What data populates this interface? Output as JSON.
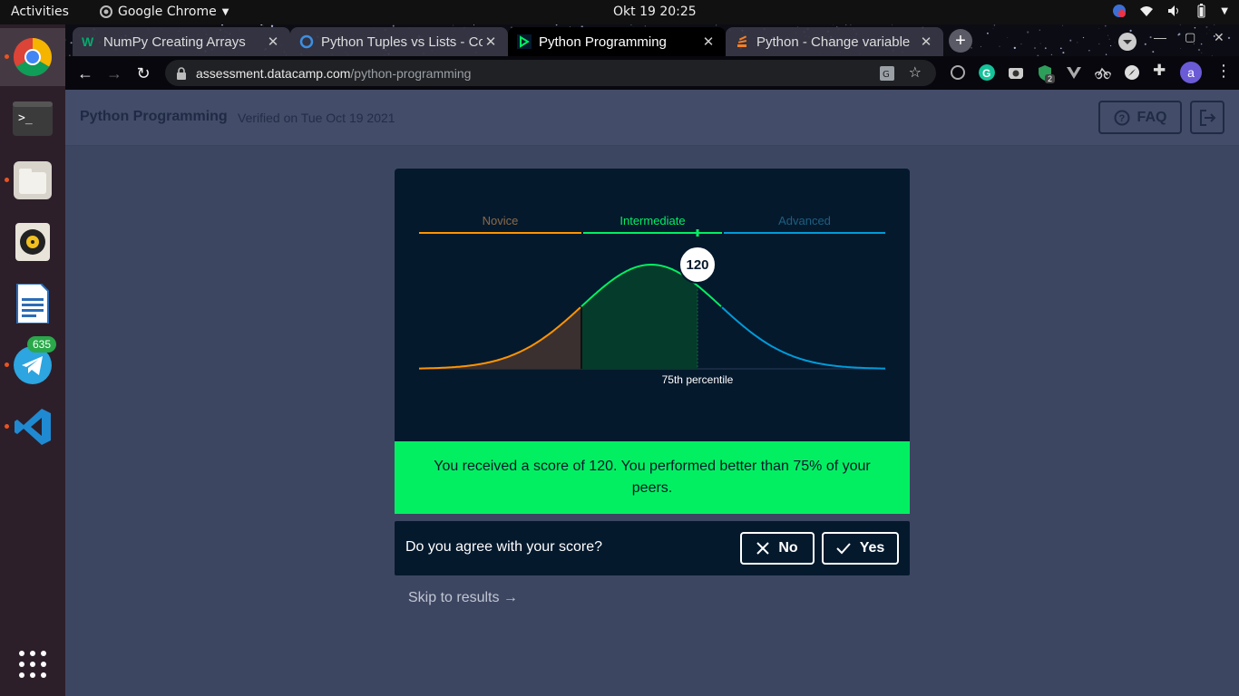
{
  "system": {
    "activities": "Activities",
    "app_name": "Google Chrome",
    "clock": "Okt 19  20:25"
  },
  "dock": {
    "telegram_badge": "635"
  },
  "tabs": [
    {
      "title": "NumPy Creating Arrays",
      "icon": "w-favicon-icon"
    },
    {
      "title": "Python Tuples vs Lists - Co",
      "icon": "globe-favicon-icon"
    },
    {
      "title": "Python Programming",
      "icon": "datacamp-favicon-icon"
    },
    {
      "title": "Python - Change variable",
      "icon": "stackoverflow-favicon-icon"
    }
  ],
  "omnibox": {
    "host": "assessment.datacamp.com",
    "path": "/python-programming"
  },
  "extensions": {
    "badge_count": "2",
    "profile_initial": "a"
  },
  "header": {
    "title": "Python Programming",
    "verified": "Verified on Tue Oct 19 2021",
    "faq_label": "FAQ"
  },
  "chart_data": {
    "type": "area",
    "levels": [
      {
        "name": "Novice",
        "color": "#ff9400"
      },
      {
        "name": "Intermediate",
        "color": "#03ef62"
      },
      {
        "name": "Advanced",
        "color": "#009bd8"
      }
    ],
    "score": "120",
    "percentile_label": "75th percentile",
    "percentile": 75
  },
  "result": {
    "message": "You received a score of 120. You performed better than 75% of your peers."
  },
  "agree": {
    "question": "Do you agree with your score?",
    "no_label": "No",
    "yes_label": "Yes"
  },
  "skip_label": "Skip to results →",
  "colors": {
    "brand_green": "#03ef62",
    "navy": "#05192d",
    "page_bg": "#3d4661"
  }
}
